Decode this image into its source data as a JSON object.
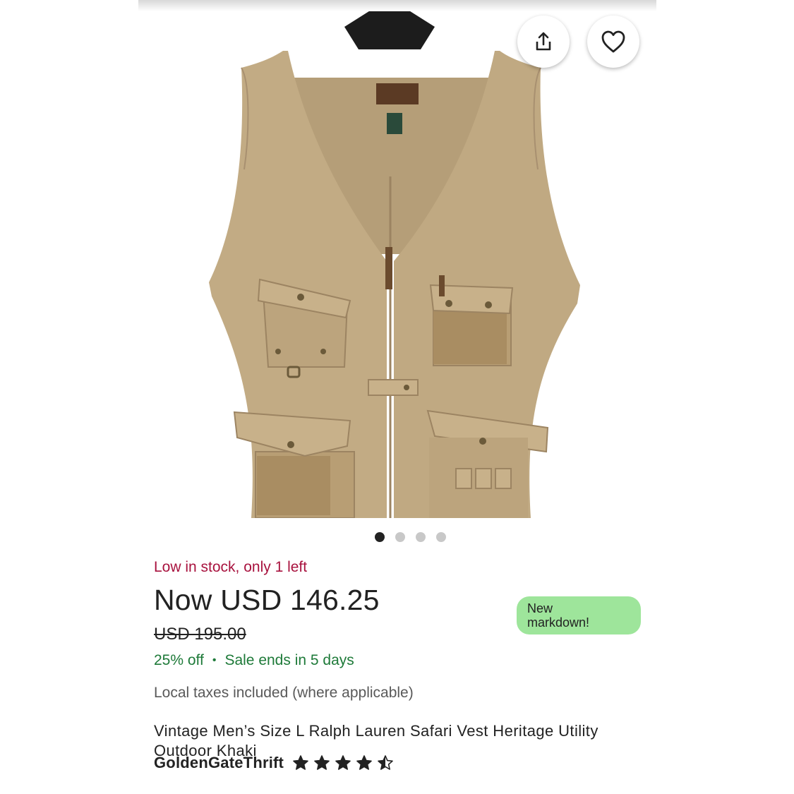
{
  "product_photo": {
    "description_icon": "vest-photo",
    "carousel": {
      "total": 4,
      "active_index": 0
    }
  },
  "actions": {
    "share_icon": "share-icon",
    "favorite_icon": "heart-icon"
  },
  "listing": {
    "stock_notice": "Low in stock, only 1 left",
    "current_price": "Now USD 146.25",
    "original_price": "USD 195.00",
    "discount": "25% off",
    "separator": "•",
    "sale_ends": "Sale ends in 5 days",
    "taxes_note": "Local taxes included (where applicable)",
    "title": "Vintage Men’s Size L Ralph Lauren Safari Vest Heritage Utility Outdoor Khaki",
    "badge_line1": "New",
    "badge_line2": "markdown!"
  },
  "seller": {
    "name": "GoldenGateThrift",
    "rating": 4.5,
    "max_rating": 5
  },
  "colors": {
    "stock_red": "#a8123e",
    "sale_green": "#1e7a39",
    "badge_green": "#9ee59b",
    "vest_khaki": "#c2ab84"
  }
}
